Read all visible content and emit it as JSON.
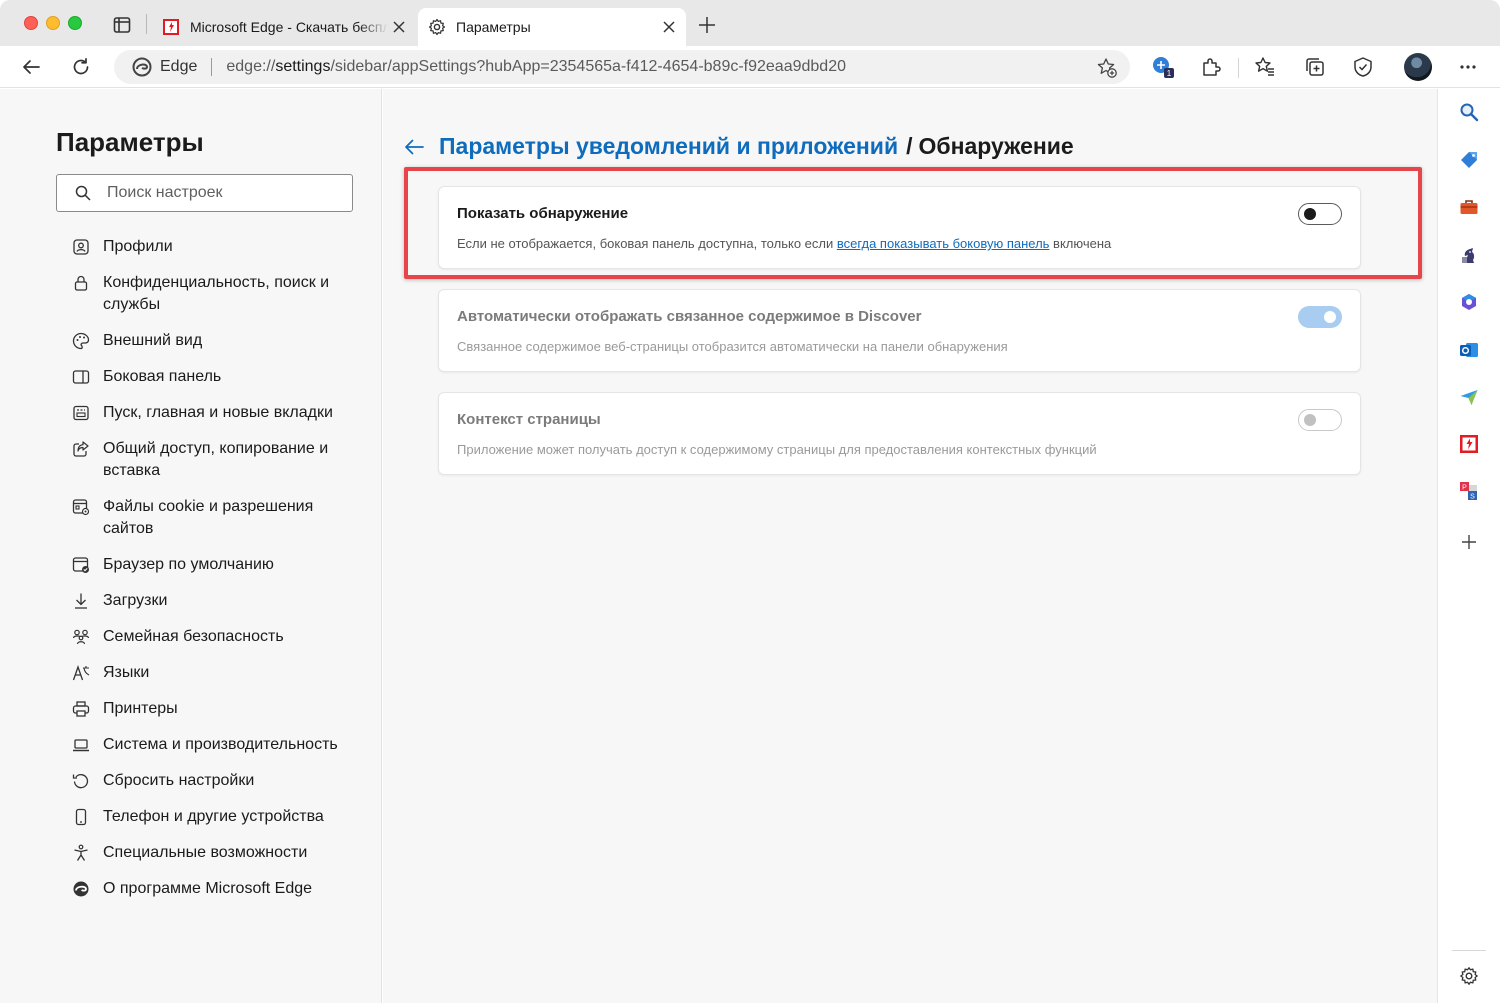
{
  "browser": {
    "tabs": [
      {
        "title": "Microsoft Edge - Скачать бесплатно",
        "active": false
      },
      {
        "title": "Параметры",
        "active": true
      }
    ],
    "address": {
      "site_name": "Edge",
      "url_prefix": "edge://",
      "url_bold": "settings",
      "url_rest": "/sidebar/appSettings?hubApp=2354565a-f412-4654-b89c-f92eaa9dbd20"
    },
    "extension_badge": "1",
    "colors": {
      "accent": "#0f6cbd",
      "highlight": "#e8454a"
    }
  },
  "settings": {
    "title": "Параметры",
    "search_placeholder": "Поиск настроек",
    "nav": [
      {
        "icon": "profile-icon",
        "label": "Профили"
      },
      {
        "icon": "lock-icon",
        "label": "Конфиденциальность, поиск и службы"
      },
      {
        "icon": "palette-icon",
        "label": "Внешний вид"
      },
      {
        "icon": "sidebar-icon",
        "label": "Боковая панель"
      },
      {
        "icon": "home-icon",
        "label": "Пуск, главная и новые вкладки"
      },
      {
        "icon": "share-icon",
        "label": "Общий доступ, копирование и вставка"
      },
      {
        "icon": "cookie-icon",
        "label": "Файлы cookie и разрешения сайтов"
      },
      {
        "icon": "default-browser-icon",
        "label": "Браузер по умолчанию"
      },
      {
        "icon": "download-icon",
        "label": "Загрузки"
      },
      {
        "icon": "family-icon",
        "label": "Семейная безопасность"
      },
      {
        "icon": "languages-icon",
        "label": "Языки"
      },
      {
        "icon": "printer-icon",
        "label": "Принтеры"
      },
      {
        "icon": "laptop-icon",
        "label": "Система и производительность"
      },
      {
        "icon": "reset-icon",
        "label": "Сбросить настройки"
      },
      {
        "icon": "phone-icon",
        "label": "Телефон и другие устройства"
      },
      {
        "icon": "accessibility-icon",
        "label": "Специальные возможности"
      },
      {
        "icon": "edge-logo-icon",
        "label": "О программе Microsoft Edge"
      }
    ]
  },
  "page": {
    "breadcrumb_parent": "Параметры уведомлений и приложений",
    "breadcrumb_separator": "/",
    "breadcrumb_current": "Обнаружение",
    "cards": [
      {
        "title": "Показать обнаружение",
        "desc_before": "Если не отображается, боковая панель доступна, только если ",
        "desc_link": "всегда показывать боковую панель",
        "desc_after": " включена",
        "toggle": "off",
        "disabled": false
      },
      {
        "title": "Автоматически отображать связанное содержимое в Discover",
        "desc": "Связанное содержимое веб-страницы отобразится автоматически на панели обнаружения",
        "toggle": "on",
        "disabled": true
      },
      {
        "title": "Контекст страницы",
        "desc": "Приложение может получать доступ к содержимому страницы для предоставления контекстных функций",
        "toggle": "off",
        "disabled": true
      }
    ]
  },
  "right_sidebar": {
    "icons": [
      "search-icon",
      "tag-icon",
      "toolbox-icon",
      "chess-icon",
      "office-icon",
      "outlook-icon",
      "send-icon",
      "brand-app-icon",
      "pcs-app-icon",
      "add-icon",
      "settings-icon"
    ]
  }
}
